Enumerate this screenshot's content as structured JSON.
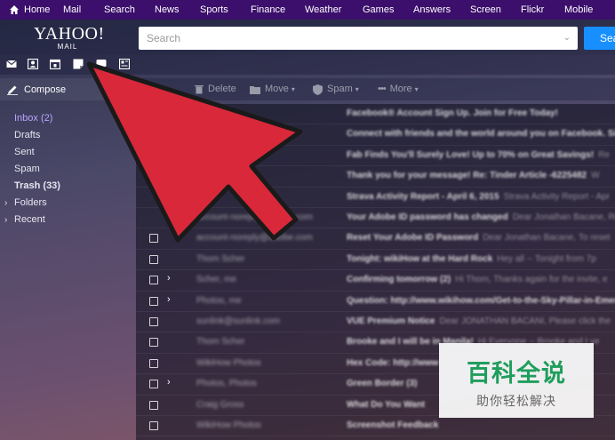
{
  "topnav": {
    "items": [
      "Home",
      "Mail",
      "Search",
      "News",
      "Sports",
      "Finance",
      "Weather",
      "Games",
      "Answers",
      "Screen",
      "Flickr",
      "Mobile"
    ]
  },
  "header": {
    "logo_main": "YAHOO!",
    "logo_sub": "MAIL",
    "search_placeholder": "Search",
    "search_button": "Sea"
  },
  "icons": [
    "mail-icon",
    "contacts-icon",
    "calendar-icon",
    "notepad-icon",
    "messenger-icon",
    "newsfeed-icon"
  ],
  "sidebar": {
    "compose": "Compose",
    "folders": [
      {
        "label": "Inbox (2)",
        "active": true,
        "bold": false,
        "caret": ""
      },
      {
        "label": "Drafts",
        "active": false,
        "bold": false,
        "caret": ""
      },
      {
        "label": "Sent",
        "active": false,
        "bold": false,
        "caret": ""
      },
      {
        "label": "Spam",
        "active": false,
        "bold": false,
        "caret": ""
      },
      {
        "label": "Trash (33)",
        "active": false,
        "bold": true,
        "caret": ""
      },
      {
        "label": "Folders",
        "active": false,
        "bold": false,
        "caret": "›"
      },
      {
        "label": "Recent",
        "active": false,
        "bold": false,
        "caret": "›"
      }
    ]
  },
  "toolbar": {
    "delete": "Delete",
    "move": "Move",
    "spam": "Spam",
    "more": "More"
  },
  "messages": [
    {
      "sender": "",
      "subject": "Facebook® Account Sign Up. Join for Free Today!",
      "preview": "",
      "expand": false,
      "checkbox": false
    },
    {
      "sender": "",
      "subject": "Connect with friends and the world around you on Facebook. Sig",
      "preview": "",
      "expand": false,
      "checkbox": false
    },
    {
      "sender": "",
      "subject": "Fab Finds You'll Surely Love! Up to 70% on Great Savings!",
      "preview": "Re",
      "expand": false,
      "checkbox": false
    },
    {
      "sender": "",
      "subject": "Thank you for your message! Re: Tinder Article -6225482",
      "preview": "W",
      "expand": false,
      "checkbox": false
    },
    {
      "sender": "",
      "subject": "Strava Activity Report - April 6, 2015",
      "preview": "Strava Activity Report - Apr",
      "expand": false,
      "checkbox": false
    },
    {
      "sender": "account-noreply@adobe.com",
      "subject": "Your Adobe ID password has changed",
      "preview": "Dear Jonathan Bacane, Re",
      "expand": false,
      "checkbox": false
    },
    {
      "sender": "account-noreply@adobe.com",
      "subject": "Reset Your Adobe ID Password",
      "preview": "Dear Jonathan Bacane, To reset",
      "expand": false,
      "checkbox": true
    },
    {
      "sender": "Thom Scher",
      "subject": "Tonight: wikiHow at the Hard Rock",
      "preview": "Hey all -- Tonight from 7p",
      "expand": false,
      "checkbox": true
    },
    {
      "sender": "Scher, me",
      "subject": "Confirming tomorrow (2)",
      "preview": "Hi Thom, Thanks again for the invite, e",
      "expand": true,
      "checkbox": true
    },
    {
      "sender": "Photos, me",
      "subject": "Question: http://www.wikihow.com/Get-to-the-Sky-Pillar-in-Emer",
      "preview": "",
      "expand": true,
      "checkbox": true
    },
    {
      "sender": "sunlink@sunlink.com",
      "subject": "VUE Premium Notice",
      "preview": "Dear JONATHAN BACANI, Please click the",
      "expand": false,
      "checkbox": true
    },
    {
      "sender": "Thom Scher",
      "subject": "Brooke and I will be in Manila!",
      "preview": "Hi Everyone -- Brooke and I ve",
      "expand": false,
      "checkbox": true
    },
    {
      "sender": "WikiHow Photos",
      "subject": "Hex Code: http://www",
      "preview": "",
      "expand": false,
      "checkbox": true
    },
    {
      "sender": "Photos, Photos",
      "subject": "Green Border (3)",
      "preview": "",
      "expand": true,
      "checkbox": true
    },
    {
      "sender": "Craig Gross",
      "subject": "What Do You Want",
      "preview": "",
      "expand": false,
      "checkbox": true
    },
    {
      "sender": "WikiHow Photos",
      "subject": "Screenshot Feedback",
      "preview": "",
      "expand": false,
      "checkbox": true
    },
    {
      "sender": "",
      "subject": "",
      "preview": "",
      "expand": false,
      "checkbox": true
    }
  ],
  "watermark": {
    "title": "百科全说",
    "subtitle": "助你轻松解决"
  },
  "colors": {
    "topnav": "#3b0f6b",
    "search_button": "#188fff",
    "arrow": "#d9283a",
    "inbox_active": "#b9a4ff",
    "watermark_green": "#1f9e5c"
  }
}
